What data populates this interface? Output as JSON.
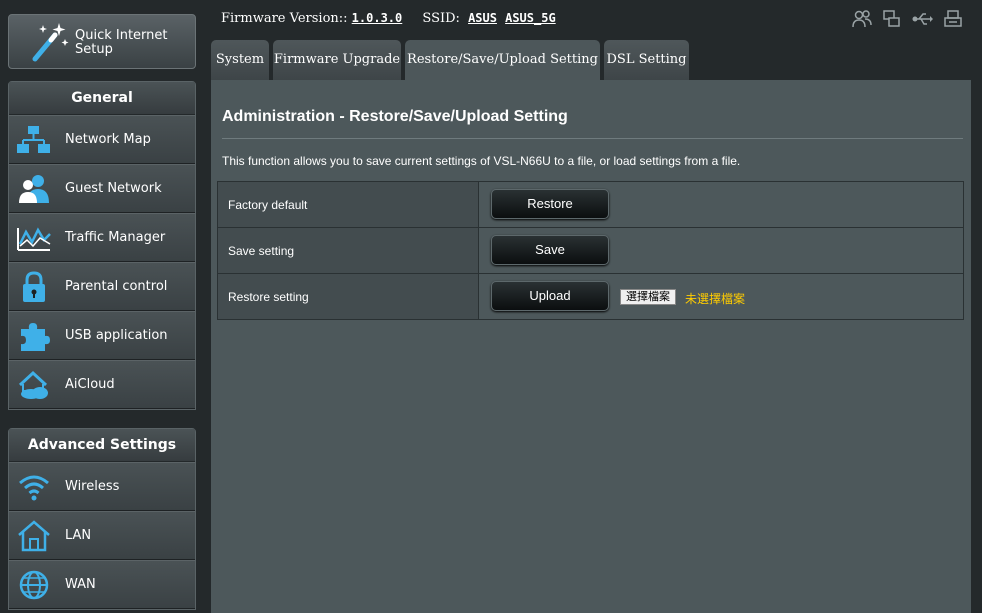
{
  "sidebar": {
    "quick_setup": {
      "label_line1": "Quick Internet",
      "label_line2": "Setup",
      "icon": "magic-wand-icon"
    },
    "general": {
      "title": "General",
      "items": [
        {
          "label": "Network Map",
          "icon": "network-map-icon"
        },
        {
          "label": "Guest Network",
          "icon": "guest-network-icon"
        },
        {
          "label": "Traffic Manager",
          "icon": "traffic-manager-icon"
        },
        {
          "label": "Parental control",
          "icon": "lock-icon"
        },
        {
          "label": "USB application",
          "icon": "puzzle-icon"
        },
        {
          "label": "AiCloud",
          "icon": "cloud-home-icon"
        }
      ]
    },
    "advanced": {
      "title": "Advanced Settings",
      "items": [
        {
          "label": "Wireless",
          "icon": "wifi-icon"
        },
        {
          "label": "LAN",
          "icon": "home-icon"
        },
        {
          "label": "WAN",
          "icon": "globe-icon"
        }
      ]
    }
  },
  "header": {
    "firmware_label": "Firmware Version::",
    "firmware_value": "1.0.3.0",
    "ssid_label": "SSID:",
    "ssid_1": "ASUS",
    "ssid_2": "ASUS_5G",
    "icons": [
      "users-icon",
      "windows-icon",
      "usb-icon",
      "printer-icon"
    ]
  },
  "tabs": [
    {
      "label": "System",
      "active": false
    },
    {
      "label": "Firmware Upgrade",
      "active": false
    },
    {
      "label": "Restore/Save/Upload Setting",
      "active": true
    },
    {
      "label": "DSL Setting",
      "active": false
    }
  ],
  "main": {
    "title": "Administration - Restore/Save/Upload Setting",
    "description": "This function allows you to save current settings of VSL-N66U to a file, or load settings from a file.",
    "rows": [
      {
        "label": "Factory default",
        "button": "Restore"
      },
      {
        "label": "Save setting",
        "button": "Save"
      },
      {
        "label": "Restore setting",
        "button": "Upload",
        "file_button": "選擇檔案",
        "file_status": "未選擇檔案"
      }
    ]
  },
  "colors": {
    "accent_blue": "#3fb0e8",
    "file_status": "#ffcc00",
    "content_bg": "#4d585b"
  }
}
